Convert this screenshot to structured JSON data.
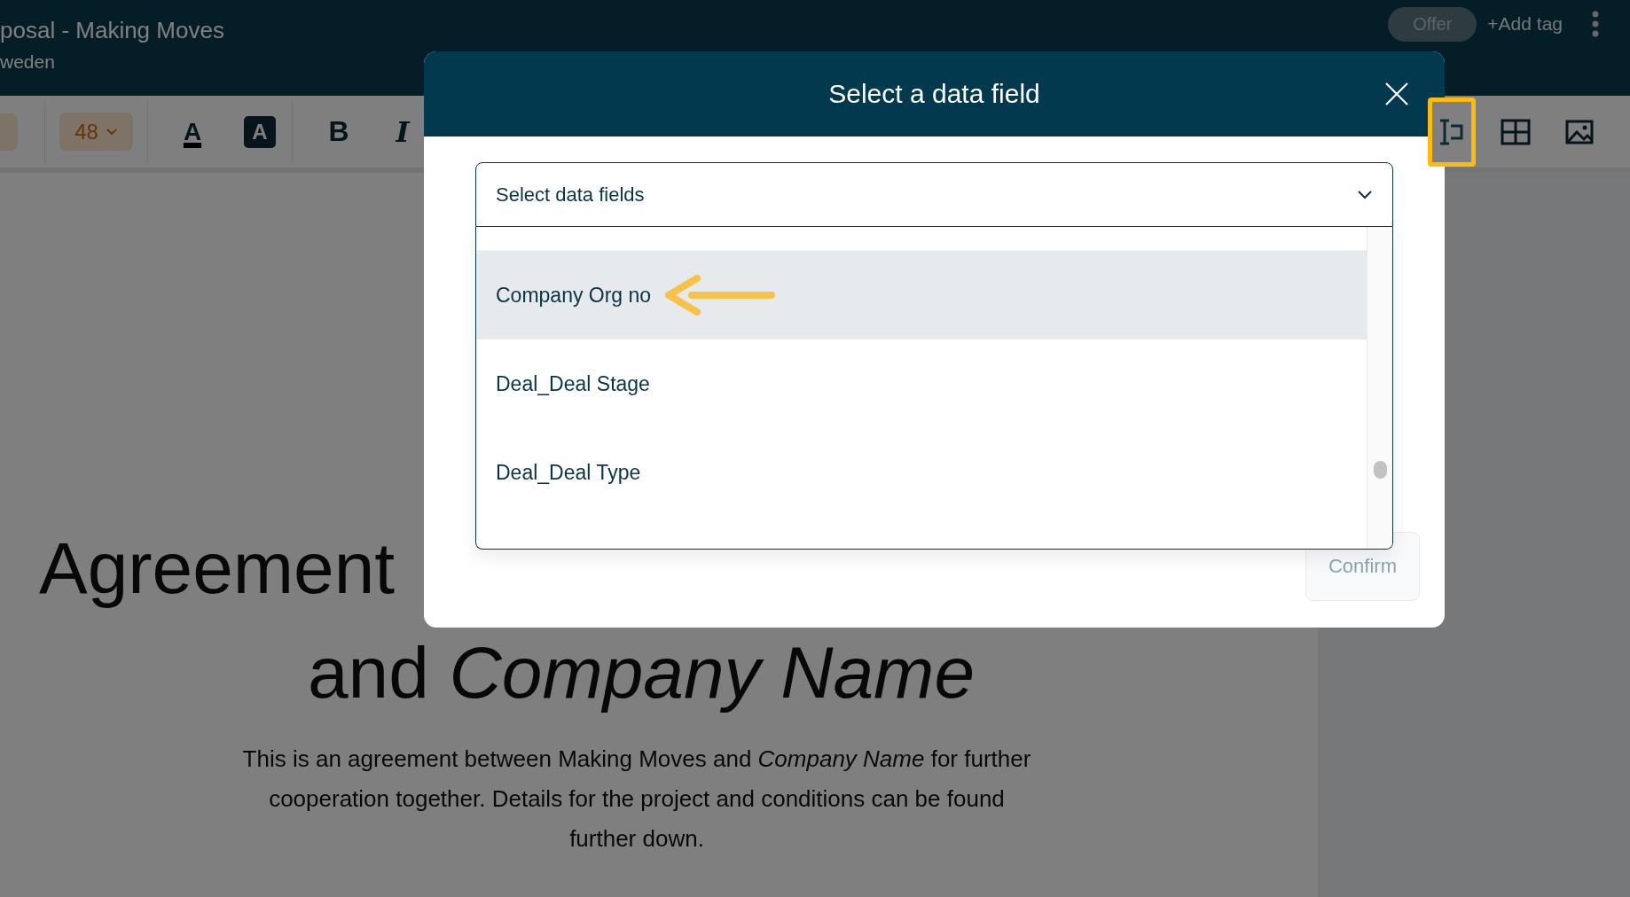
{
  "header": {
    "title": "posal - Making Moves",
    "subtitle": "weden",
    "tag": "Offer",
    "add_tag": "+Add tag"
  },
  "toolbar": {
    "font_size": "48",
    "tools": [
      {
        "kind": "text_color",
        "label": "A"
      },
      {
        "kind": "highlight",
        "label": "A"
      },
      {
        "kind": "bold",
        "label": "B"
      },
      {
        "kind": "italic",
        "label": "I"
      }
    ],
    "insert_tools": [
      {
        "kind": "data_field",
        "highlighted": true
      },
      {
        "kind": "table",
        "highlighted": false
      },
      {
        "kind": "image",
        "highlighted": false
      }
    ]
  },
  "document": {
    "heading_line_1": "Agreement",
    "heading_line_2": "and *Company Name*",
    "paragraph": "This is an agreement between Making Moves and *Company Name* for further cooperation together. Details for the project and conditions can be found further down."
  },
  "dialog": {
    "title": "Select a data field",
    "dropdown": {
      "placeholder": "Select data fields",
      "options": [
        {
          "label": "Company Org no",
          "selected": true,
          "annotated": true
        },
        {
          "label": "Deal_Deal Stage",
          "selected": false,
          "annotated": false
        },
        {
          "label": "Deal_Deal Type",
          "selected": false,
          "annotated": false
        }
      ]
    },
    "confirm": {
      "label": "Confirm",
      "disabled": true
    }
  }
}
